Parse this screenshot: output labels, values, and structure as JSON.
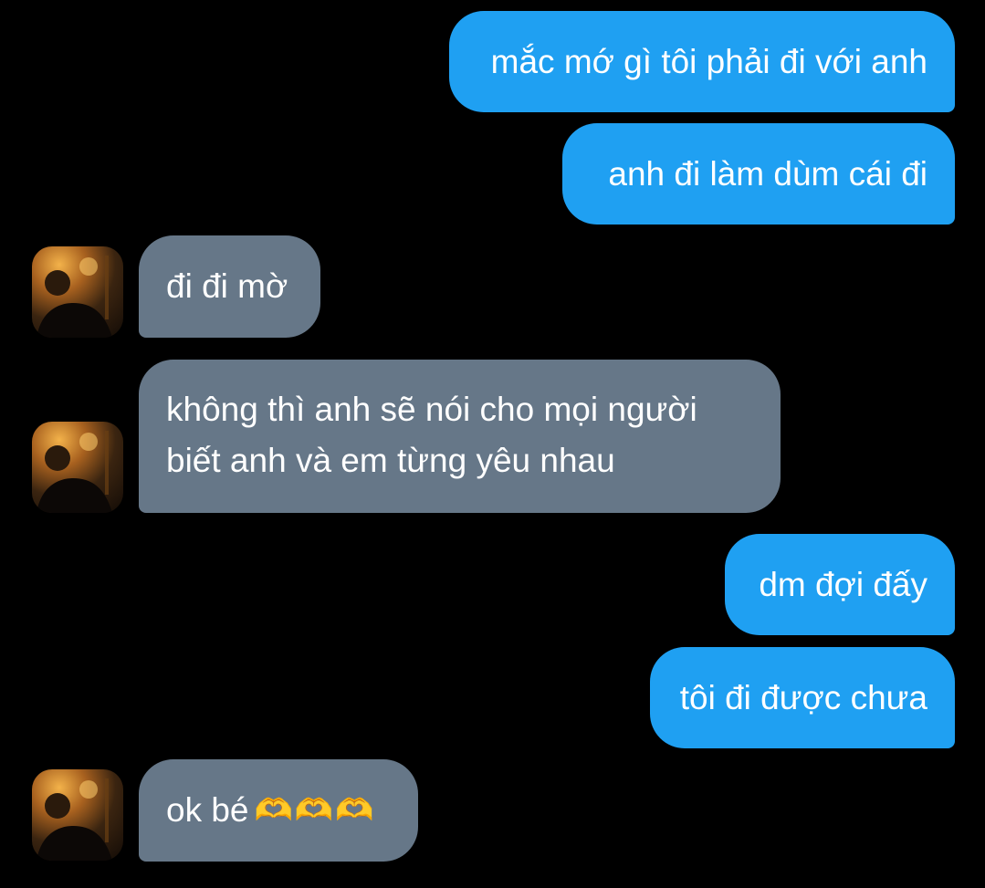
{
  "messages": [
    {
      "side": "sent",
      "text": "mắc mớ gì tôi phải đi với anh"
    },
    {
      "side": "sent",
      "text": "anh đi làm dùm cái đi"
    },
    {
      "side": "received",
      "text": "đi đi mờ"
    },
    {
      "side": "received",
      "lines": [
        "không thì anh sẽ nói cho mọi người",
        "biết anh và em từng yêu nhau"
      ]
    },
    {
      "side": "sent",
      "text": "dm đợi đấy"
    },
    {
      "side": "sent",
      "text": "tôi đi được chưa"
    },
    {
      "side": "received",
      "text": "ok bé",
      "emoji": "🫶🫶🫶"
    }
  ],
  "colors": {
    "sent_bubble": "#1fa0f2",
    "received_bubble": "#667788",
    "background": "#000000"
  },
  "icons": {
    "avatar": "contact-avatar-photo"
  }
}
